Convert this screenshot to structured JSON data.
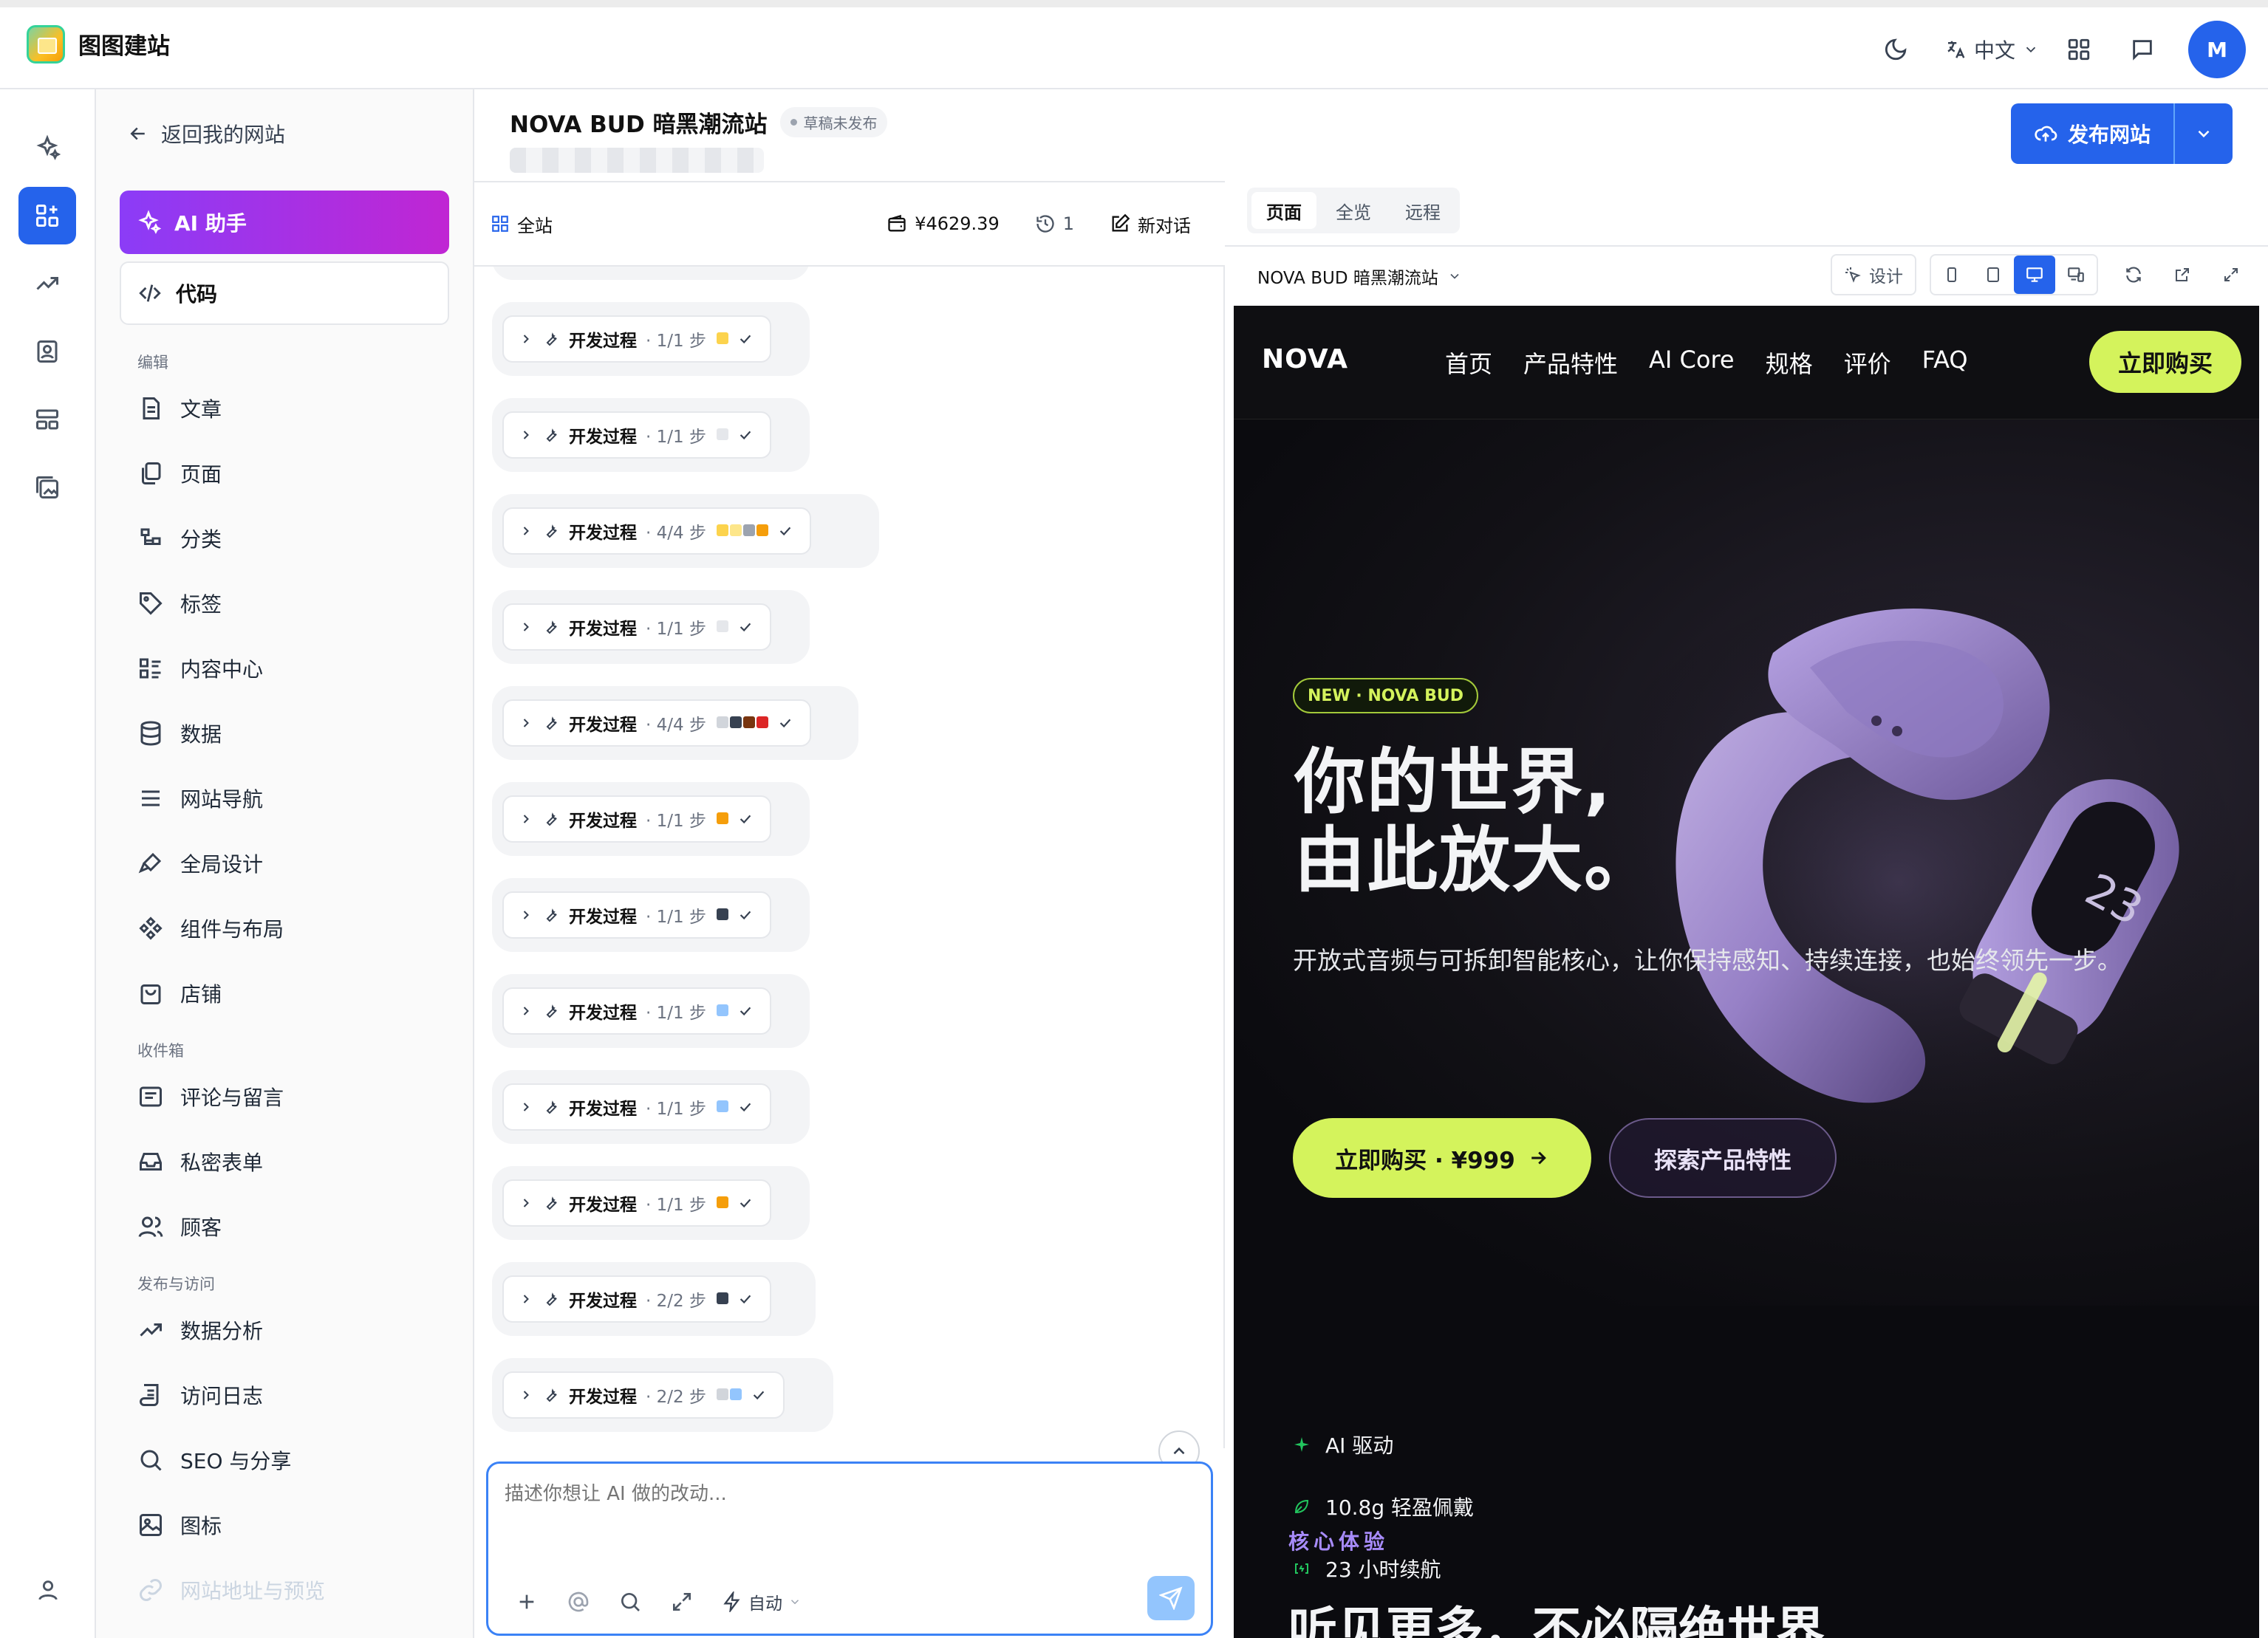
{
  "app": {
    "title": "图图建站",
    "lang": "中文",
    "avatar": "M"
  },
  "sidebar": {
    "back": "返回我的网站",
    "ai_assistant": "AI 助手",
    "code": "代码",
    "sections": [
      {
        "title": "编辑",
        "items": [
          "文章",
          "页面",
          "分类",
          "标签",
          "内容中心",
          "数据",
          "网站导航",
          "全局设计",
          "组件与布局",
          "店铺"
        ]
      },
      {
        "title": "收件箱",
        "items": [
          "评论与留言",
          "私密表单",
          "顾客"
        ]
      },
      {
        "title": "发布与访问",
        "items": [
          "数据分析",
          "访问日志",
          "SEO 与分享",
          "图标",
          "网站地址与预览"
        ]
      }
    ]
  },
  "project": {
    "name": "NOVA BUD 暗黑潮流站",
    "status": "草稿未发布",
    "publish": "发布网站"
  },
  "chat": {
    "scope": "全站",
    "cost": "¥4629.39",
    "history_count": "1",
    "new_chat": "新对话",
    "steps": [
      {
        "label": "开发过程",
        "progress": "· 1/1 步",
        "emoji": [
          "#fcd34d"
        ]
      },
      {
        "label": "开发过程",
        "progress": "· 1/1 步",
        "emoji": [
          "#e5e7eb"
        ]
      },
      {
        "label": "开发过程",
        "progress": "· 4/4 步",
        "emoji": [
          "#fcd34d",
          "#fde68a",
          "#9ca3af",
          "#f59e0b"
        ]
      },
      {
        "label": "开发过程",
        "progress": "· 1/1 步",
        "emoji": [
          "#e5e7eb"
        ]
      },
      {
        "label": "开发过程",
        "progress": "· 4/4 步",
        "emoji": [
          "#d1d5db",
          "#374151",
          "#78350f",
          "#dc2626"
        ]
      },
      {
        "label": "开发过程",
        "progress": "· 1/1 步",
        "emoji": [
          "#f59e0b"
        ]
      },
      {
        "label": "开发过程",
        "progress": "· 1/1 步",
        "emoji": [
          "#374151"
        ]
      },
      {
        "label": "开发过程",
        "progress": "· 1/1 步",
        "emoji": [
          "#93c5fd"
        ]
      },
      {
        "label": "开发过程",
        "progress": "· 1/1 步",
        "emoji": [
          "#93c5fd"
        ]
      },
      {
        "label": "开发过程",
        "progress": "· 1/1 步",
        "emoji": [
          "#f59e0b"
        ]
      },
      {
        "label": "开发过程",
        "progress": "· 2/2 步",
        "emoji": [
          "#374151"
        ]
      },
      {
        "label": "开发过程",
        "progress": "· 2/2 步",
        "emoji": [
          "#d1d5db",
          "#93c5fd"
        ]
      }
    ],
    "input_placeholder": "描述你想让 AI 做的改动...",
    "mode": "自动"
  },
  "preview": {
    "tabs": [
      "页面",
      "全览",
      "远程"
    ],
    "page_name": "NOVA BUD 暗黑潮流站",
    "design": "设计",
    "site": {
      "brand": "NOVA",
      "links": [
        "首页",
        "产品特性",
        "AI Core",
        "规格",
        "评价",
        "FAQ"
      ],
      "buy": "立即购买",
      "pill": "NEW · NOVA BUD",
      "headline_1": "你的世界,",
      "headline_2": "由此放大。",
      "subtitle": "开放式音频与可拆卸智能核心，让你保持感知、持续连接，也始终领先一步。",
      "cta_primary": "立即购买 · ¥999",
      "cta_secondary": "探索产品特性",
      "features": [
        "AI 驱动",
        "10.8g 轻盈佩戴",
        "23 小时续航"
      ],
      "core_label": "23",
      "kicker": "核心体验",
      "section_title": "听见更多，不必隔绝世界"
    }
  },
  "colors": {
    "accent": "#2563eb",
    "ai_gradient": [
      "#8b3cf7",
      "#c026d3"
    ],
    "lime": "#d4f35c"
  }
}
